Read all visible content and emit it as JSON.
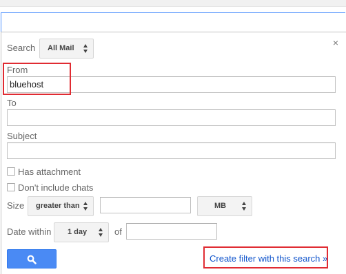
{
  "search": {
    "label": "Search",
    "scope": "All Mail"
  },
  "from": {
    "label": "From",
    "value": "bluehost"
  },
  "to": {
    "label": "To",
    "value": ""
  },
  "subject": {
    "label": "Subject",
    "value": ""
  },
  "options": {
    "has_attachment": {
      "label": "Has attachment",
      "checked": false
    },
    "dont_include_chats": {
      "label": "Don't include chats",
      "checked": false
    }
  },
  "size": {
    "label": "Size",
    "operator": "greater than",
    "value": "",
    "unit": "MB"
  },
  "date": {
    "label": "Date within",
    "range": "1 day",
    "of_label": "of",
    "value": ""
  },
  "actions": {
    "create_filter_label": "Create filter with this search »",
    "close_glyph": "×"
  },
  "icons": {
    "search_button": "search-icon",
    "close": "close-icon",
    "select_arrows": "updown-arrows-icon"
  },
  "colors": {
    "highlight": "#e02b32",
    "primary_button": "#4a8af4",
    "link": "#1155cc",
    "focus_border": "#4d90fe"
  }
}
